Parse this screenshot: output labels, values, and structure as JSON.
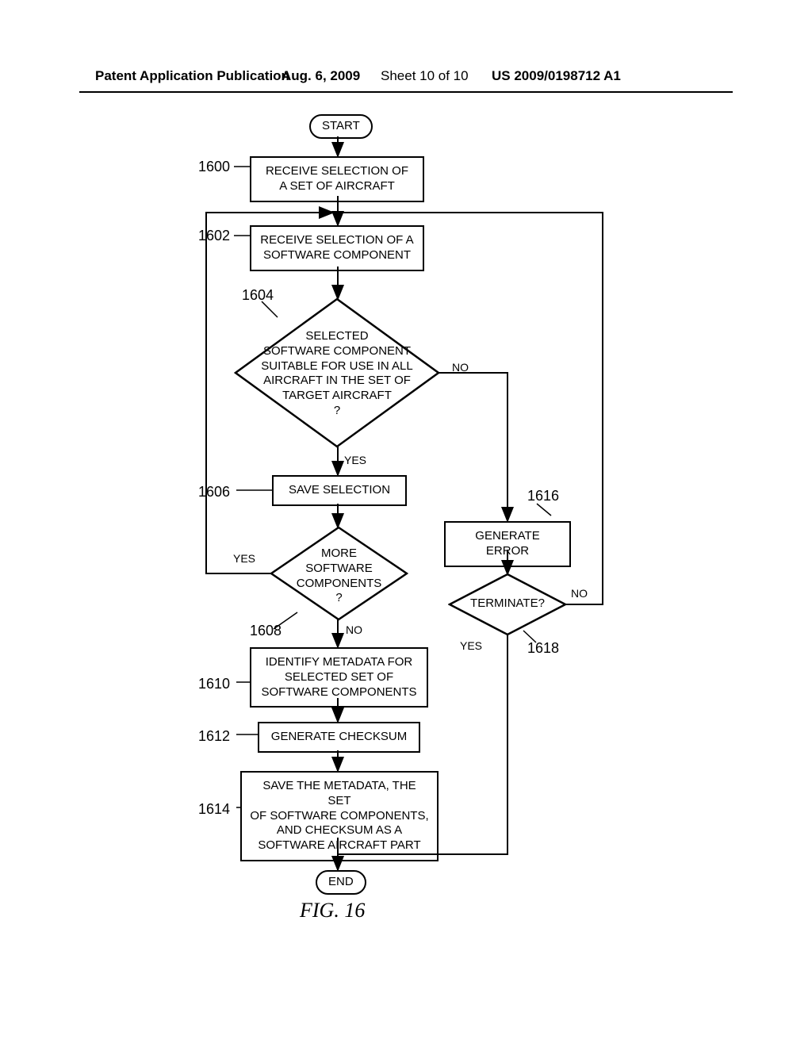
{
  "header": {
    "pub_label": "Patent Application Publication",
    "date": "Aug. 6, 2009",
    "sheet": "Sheet 10 of 10",
    "pubno": "US 2009/0198712 A1"
  },
  "nodes": {
    "start": "START",
    "n1600": "RECEIVE SELECTION OF\nA SET OF AIRCRAFT",
    "n1602": "RECEIVE SELECTION OF A\nSOFTWARE COMPONENT",
    "n1604": "SELECTED\nSOFTWARE COMPONENT\nSUITABLE FOR USE IN ALL\nAIRCRAFT IN THE SET OF\nTARGET AIRCRAFT\n?",
    "n1606": "SAVE SELECTION",
    "n1608": "MORE\nSOFTWARE\nCOMPONENTS\n?",
    "n1610": "IDENTIFY METADATA FOR\nSELECTED SET OF\nSOFTWARE COMPONENTS",
    "n1612": "GENERATE CHECKSUM",
    "n1614": "SAVE THE METADATA, THE SET\nOF SOFTWARE COMPONENTS,\nAND CHECKSUM AS A\nSOFTWARE AIRCRAFT PART",
    "n1616": "GENERATE ERROR",
    "n1618": "TERMINATE?",
    "end": "END"
  },
  "refs": {
    "r1600": "1600",
    "r1602": "1602",
    "r1604": "1604",
    "r1606": "1606",
    "r1608": "1608",
    "r1610": "1610",
    "r1612": "1612",
    "r1614": "1614",
    "r1616": "1616",
    "r1618": "1618"
  },
  "labels": {
    "yes": "YES",
    "no": "NO"
  },
  "figure": "FIG. 16"
}
